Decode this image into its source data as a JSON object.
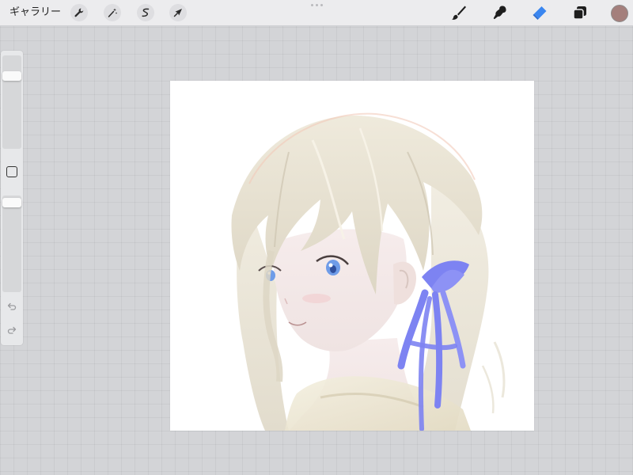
{
  "toolbar": {
    "gallery_label": "ギャラリー",
    "left_tools": [
      {
        "icon": "wrench-icon",
        "name": "actions"
      },
      {
        "icon": "magic-wand-icon",
        "name": "adjustments"
      },
      {
        "icon": "selection-icon",
        "name": "selection"
      },
      {
        "icon": "transform-arrow-icon",
        "name": "transform"
      }
    ],
    "right_tools": [
      {
        "icon": "brush-icon",
        "name": "paint",
        "active": false
      },
      {
        "icon": "smudge-icon",
        "name": "smudge",
        "active": false
      },
      {
        "icon": "eraser-icon",
        "name": "erase",
        "active": true
      },
      {
        "icon": "layers-icon",
        "name": "layers",
        "active": false
      }
    ],
    "current_color": "#a47f7c",
    "active_tool_color": "#3a86f0"
  },
  "sidebar": {
    "brush_size_level": 0.81,
    "opacity_level": 0.03
  },
  "colors": {
    "workspace_bg": "#d3d4d7",
    "canvas_bg": "#ffffff",
    "ribbon": "#7d83f2",
    "hair": "#e8e2d2",
    "eye": "#6f9ce8"
  }
}
